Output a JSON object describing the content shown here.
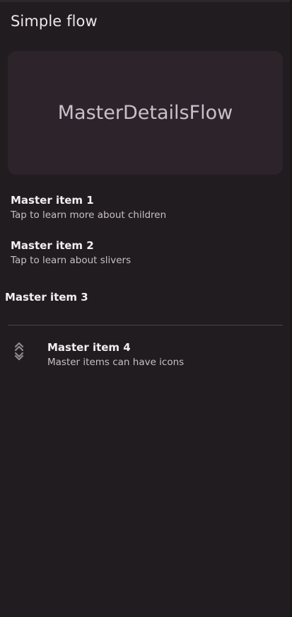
{
  "app_bar": {
    "title": "Simple flow"
  },
  "hero": {
    "text": "MasterDetailsFlow"
  },
  "items": [
    {
      "title": "Master item 1",
      "subtitle": "Tap to learn more about children"
    },
    {
      "title": "Master item 2",
      "subtitle": "Tap to learn about slivers"
    },
    {
      "title": "Master item 3"
    },
    {
      "title": "Master item 4",
      "subtitle": "Master items can have icons",
      "icon": "unfold-chevrons-icon"
    }
  ],
  "colors": {
    "background": "#201c20",
    "card": "#2c232b",
    "divider": "#4a444a",
    "text_primary": "#f4eef4",
    "text_secondary": "#c7bfc7"
  }
}
